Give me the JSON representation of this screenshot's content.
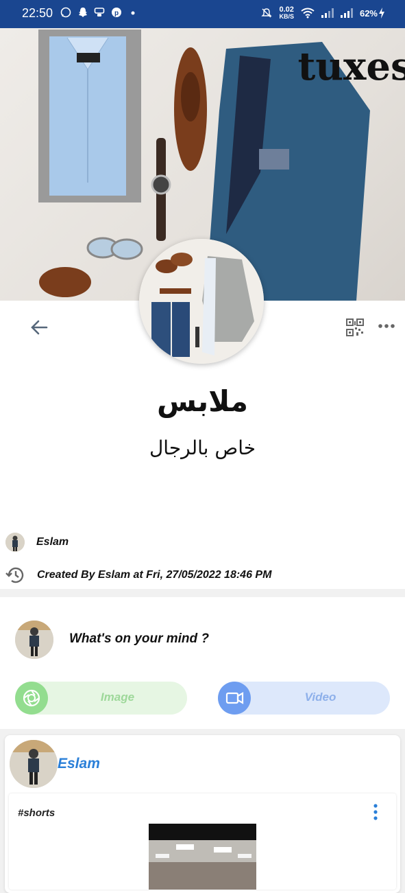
{
  "status_bar": {
    "time": "22:50",
    "net_speed": "0.02",
    "net_unit": "KB/S",
    "battery": "62%"
  },
  "cover": {
    "brand": "tuxes"
  },
  "group": {
    "title": "ملابس",
    "subtitle": "خاص بالرجال",
    "owner": "Eslam",
    "created": "Created By Eslam at Fri, 27/05/2022 18:46 PM"
  },
  "composer": {
    "prompt": "What's on your mind ?",
    "image_label": "Image",
    "video_label": "Video"
  },
  "post": {
    "author": "Eslam",
    "text": "#shorts"
  },
  "colors": {
    "status_bar": "#1a4690",
    "author_blue": "#2a7fd8",
    "image_green": "#93dd8f",
    "video_blue": "#6e9df0"
  },
  "icons": [
    "whatsapp-icon",
    "snapchat-icon",
    "notification-icon",
    "pinterest-icon",
    "mute-icon",
    "wifi-icon",
    "signal-icon",
    "battery-charging-icon",
    "back-arrow-icon",
    "qr-code-icon",
    "more-icon",
    "history-icon",
    "camera-shutter-icon",
    "video-camera-icon",
    "kebab-menu-icon"
  ]
}
